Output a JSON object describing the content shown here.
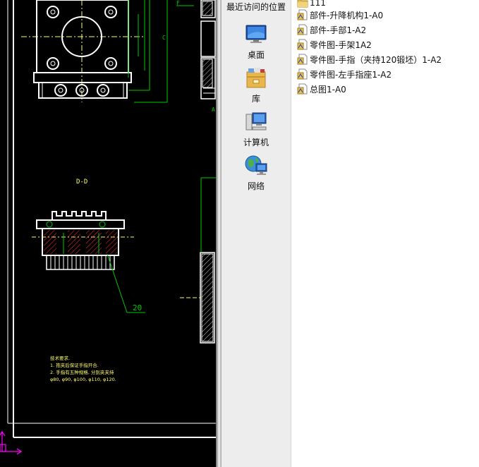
{
  "cad_drawing": {
    "section_label": "D-D",
    "callout_number": "20",
    "note_title": "技术要求.",
    "note_line1": "1. 抱夹后保证手指开合.",
    "note_line2": "2. 手指有五种规格, 分别夹夹持",
    "note_line3": "φ80, φ90, φ100, φ110, φ120.",
    "label_f": "F",
    "label_c": "C",
    "label_a": "A"
  },
  "places": {
    "recent_label": "最近访问的位置",
    "items": [
      {
        "label": "桌面",
        "icon": "desktop-icon"
      },
      {
        "label": "库",
        "icon": "library-icon"
      },
      {
        "label": "计算机",
        "icon": "computer-icon"
      },
      {
        "label": "网络",
        "icon": "network-icon"
      }
    ]
  },
  "files": [
    {
      "name": "111",
      "icon": "folder-icon"
    },
    {
      "name": "部件-升降机构1-A0",
      "icon": "dwg-file-icon"
    },
    {
      "name": "部件-手部1-A2",
      "icon": "dwg-file-icon"
    },
    {
      "name": "零件图-手架1A2",
      "icon": "dwg-file-icon"
    },
    {
      "name": "零件图-手指（夹持120锻坯）1-A2",
      "icon": "dwg-file-icon"
    },
    {
      "name": "零件图-左手指座1-A2",
      "icon": "dwg-file-icon"
    },
    {
      "name": "总图1-A0",
      "icon": "dwg-file-icon"
    }
  ],
  "colors": {
    "cad_background": "#000000",
    "cad_white": "#ffffff",
    "cad_green": "#00c800",
    "cad_yellow": "#ffff66",
    "cad_red": "#ff3030",
    "cad_magenta": "#ff00ff",
    "places_background": "#ededed"
  }
}
